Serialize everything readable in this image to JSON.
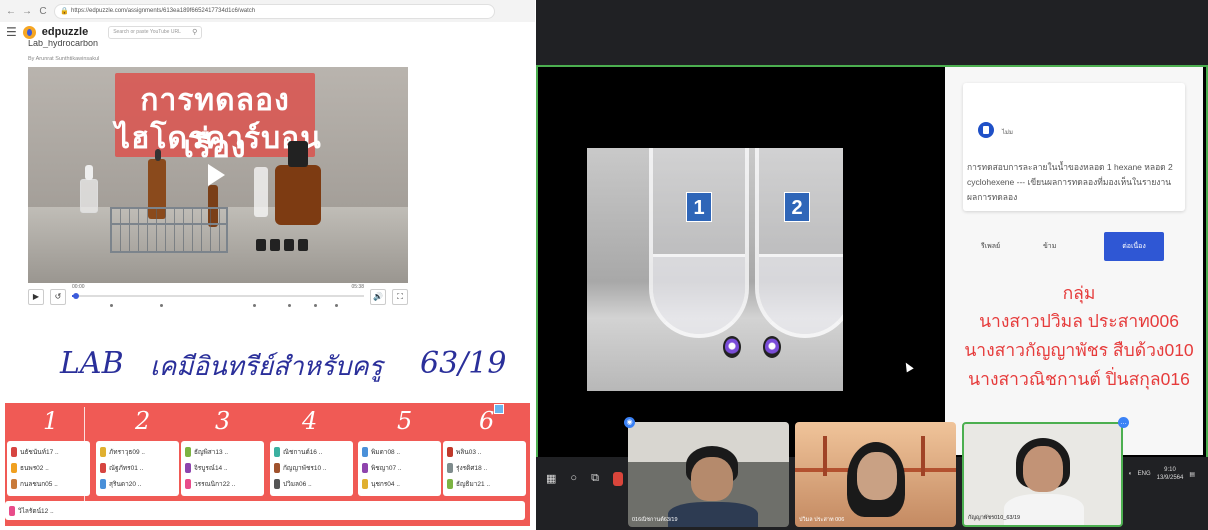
{
  "browser": {
    "back": "←",
    "forward": "→",
    "reload": "C",
    "url": "https://edpuzzle.com/assignments/613ea189f6652417734d1c6/watch"
  },
  "edpuzzle": {
    "brand": "edpuzzle",
    "search_placeholder": "Search or paste YouTube URL",
    "lesson_title": "Lab_hydrocarbon",
    "author": "By Arunrat Sunthtikawinsakul",
    "video_title_line1": "การทดลองเรื่อง",
    "video_title_line2": "ไฮโดรคาร์บอน",
    "time_current": "00:00",
    "time_total": "05:38",
    "progress": 0.01
  },
  "handwriting": {
    "lab": "LAB",
    "thai": "เคมีอินทรีย์สำหรับครู",
    "date": "63/19"
  },
  "groups": {
    "numbers": [
      "1",
      "2",
      "3",
      "4",
      "5",
      "6"
    ],
    "columns": [
      [
        "นธัชนันท์17 ..",
        "ธนพร02 ..",
        "กนลชนก05 .."
      ],
      [
        "ภัทราวุธ09 ..",
        "ณัฐภัทร01 ..",
        "สุรินดา20 .."
      ],
      [
        "ธัญพิสา13 ..",
        "จิรบูรณ์14 ..",
        "วรรณนิกา22 .."
      ],
      [
        "ณิชกานต์16 ..",
        "กัญญาพัชร10 ..",
        "ปวิมล06 .."
      ],
      [
        "พิมดา08 ..",
        "พิชญา07 ..",
        "นุชกร04 .."
      ],
      [
        "พลิน03 ..",
        "รุ่งรดิศ18 ..",
        "ธัญธิมา21 .."
      ]
    ],
    "extra": "วิไลรัตน์12 .."
  },
  "meet": {
    "tube1": "1",
    "tube2": "2",
    "question_label": "ไม่ม",
    "question_text": "การทดสอบการละลายในน้ำของหลอด 1 hexane หลอด 2 cyclohexene --- เขียนผลการทดลองที่มองเห็นในรายงานผลการทดลอง",
    "btn_rewatch": "รีเพลย์",
    "btn_skip": "ข้าม",
    "btn_continue": "ต่อเนื่อง",
    "group_title": "กลุ่ม",
    "members": [
      "นางสาวปวิมล ประสาท006",
      "นางสาวกัญญาพัชร สืบด้วง010",
      "นางสาวณิชกานต์ ปิ่นสกุล016"
    ],
    "participants": [
      "016ณิชกานต์63/19",
      "ปวิมล ประสาท 006",
      "กัญญาพัชร010_63/19"
    ],
    "tray_lang": "ENG",
    "tray_time": "9:10",
    "tray_date": "13/9/2564"
  },
  "colors": {
    "edpuzzle_blue": "#3b5bdb",
    "group_red": "#f05a55",
    "meet_green": "#4caf50",
    "continue_blue": "#2f57d4",
    "member_red": "#e63b3b"
  }
}
